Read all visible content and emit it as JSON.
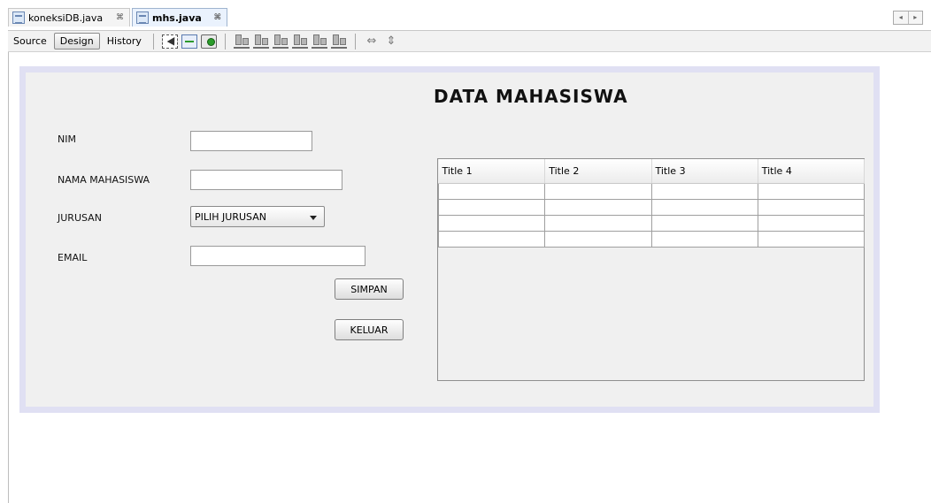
{
  "tabs": [
    {
      "label": "koneksiDB.java",
      "close": "⌘"
    },
    {
      "label": "mhs.java",
      "close": "⌘"
    }
  ],
  "tab_nav": {
    "prev": "◂",
    "next": "▸"
  },
  "toolbar": {
    "source_label": "Source",
    "design_label": "Design",
    "history_label": "History"
  },
  "form": {
    "title": "DATA MAHASISWA",
    "fields": {
      "nim_label": "NIM",
      "nama_label": "NAMA MAHASISWA",
      "jurusan_label": "JURUSAN",
      "email_label": "EMAIL",
      "jurusan_selected": "PILIH JURUSAN"
    },
    "buttons": {
      "simpan": "SIMPAN",
      "keluar": "KELUAR"
    },
    "table": {
      "columns": [
        "Title 1",
        "Title 2",
        "Title 3",
        "Title 4"
      ],
      "row_count": 4
    }
  },
  "colors": {
    "form_border": "#e0e0f3",
    "form_background": "#f0f0f0",
    "active_tab": "#eaf2fd"
  }
}
